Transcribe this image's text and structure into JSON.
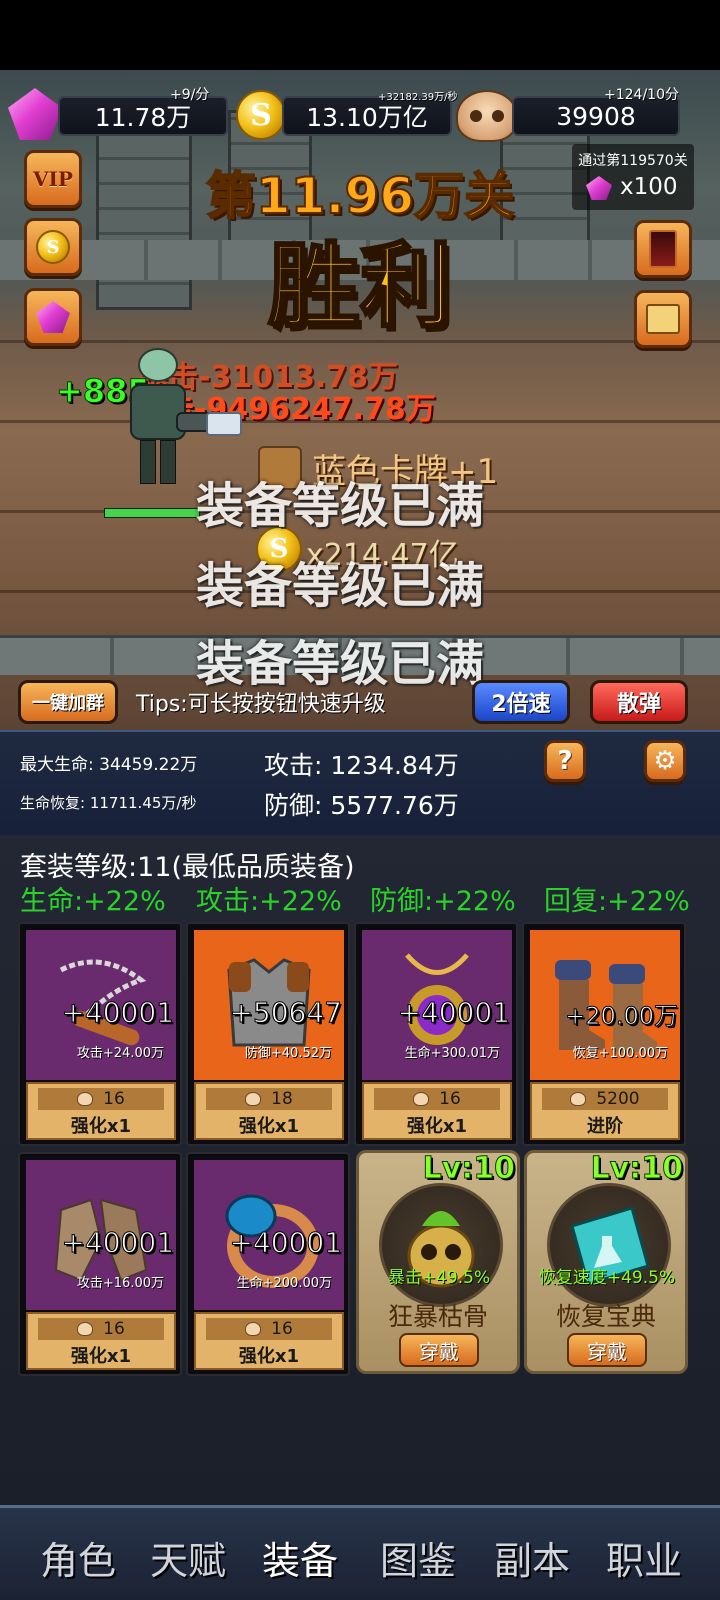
{
  "resources": {
    "gems": {
      "value": "11.78万",
      "rate": "+9/分"
    },
    "gold": {
      "value": "13.10万亿",
      "rate": "+32182.39万/秒"
    },
    "skulls": {
      "value": "39908",
      "rate": "+124/10分"
    }
  },
  "stage": {
    "title": "第11.96万关",
    "result": "胜利",
    "reward_label": "通过第119570关",
    "reward_amount": "x100"
  },
  "side_buttons": {
    "vip": "VIP"
  },
  "battle": {
    "heal_text": "+885",
    "crit_text": "暴击-9496247.78万",
    "crit_text_2": "暴击-31013.78万",
    "drop_card": "蓝色卡牌+1",
    "drop_gold": "x214.47亿",
    "max_level_msg": [
      "装备等级已满",
      "装备等级已满",
      "装备等级已满"
    ]
  },
  "action_bar": {
    "join_group": "一键加群",
    "tips": "Tips:可长按按钮快速升级",
    "speed": "2倍速",
    "scatter": "散弹"
  },
  "stats": {
    "max_hp_label": "最大生命:",
    "max_hp": "34459.22万",
    "regen_label": "生命恢复:",
    "regen": "11711.45万/秒",
    "attack_label": "攻击:",
    "attack": "1234.84万",
    "defense_label": "防御:",
    "defense": "5577.76万",
    "help": "?"
  },
  "set_bonus": {
    "title": "套装等级:11(最低品质装备)",
    "hp": "生命:+22%",
    "atk": "攻击:+22%",
    "def": "防御:+22%",
    "regen": "回复:+22%"
  },
  "equipment": [
    {
      "name": "chain-nunchaku",
      "bonus": "+40001",
      "stat": "攻击+24.00万",
      "cost": "16",
      "action": "强化x1",
      "bg": "#6a2a6e"
    },
    {
      "name": "chest-armor",
      "bonus": "+50647",
      "stat": "防御+40.52万",
      "cost": "18",
      "action": "强化x1",
      "bg": "#e8651a"
    },
    {
      "name": "amulet",
      "bonus": "+40001",
      "stat": "生命+300.01万",
      "cost": "16",
      "action": "强化x1",
      "bg": "#6a2a6e"
    },
    {
      "name": "boots",
      "bonus": "+20.00万",
      "stat": "恢复+100.00万",
      "cost": "5200",
      "action": "进阶",
      "bg": "#e8651a"
    },
    {
      "name": "gloves",
      "bonus": "+40001",
      "stat": "攻击+16.00万",
      "cost": "16",
      "action": "强化x1",
      "bg": "#6a2a6e"
    },
    {
      "name": "ring",
      "bonus": "+40001",
      "stat": "生命+200.00万",
      "cost": "16",
      "action": "强化x1",
      "bg": "#6a2a6e"
    }
  ],
  "accessories": [
    {
      "level": "Lv:10",
      "stat": "暴击+49.5%",
      "name": "狂暴枯骨",
      "action": "穿戴"
    },
    {
      "level": "Lv:10",
      "stat": "恢复速度+49.5%",
      "name": "恢复宝典",
      "action": "穿戴"
    }
  ],
  "nav": [
    "角色",
    "天赋",
    "装备",
    "图鉴",
    "副本",
    "职业"
  ]
}
